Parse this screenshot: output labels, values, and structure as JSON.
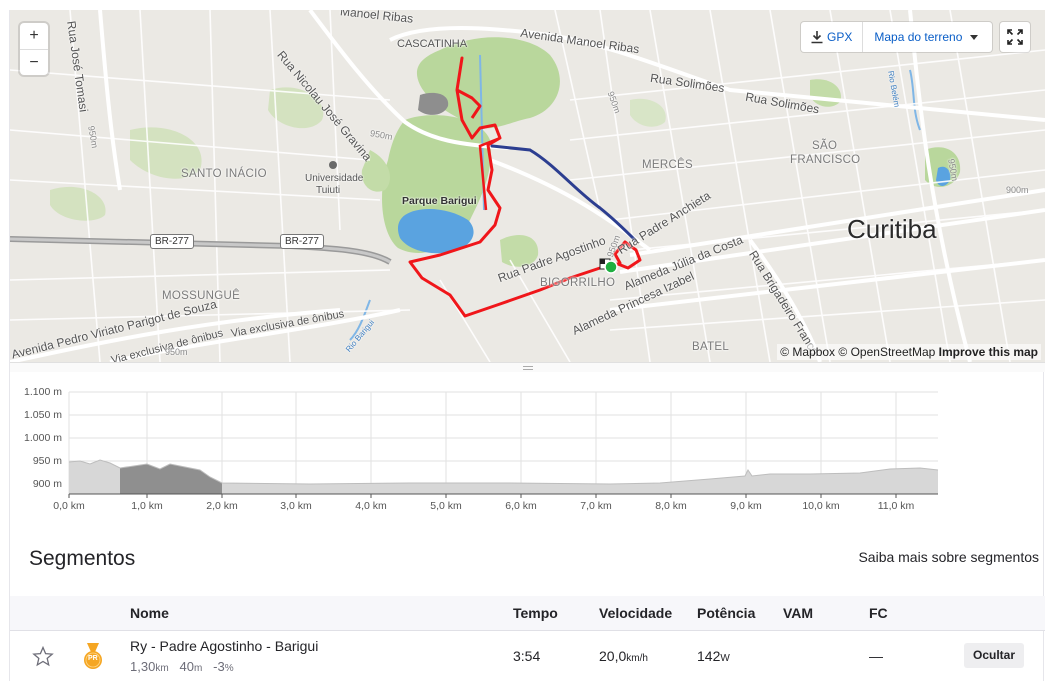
{
  "map": {
    "zoom_in": "+",
    "zoom_out": "−",
    "gpx_label": "GPX",
    "map_type": "Mapa do terreno",
    "attribution_mapbox": "© Mapbox",
    "attribution_osm": "© OpenStreetMap",
    "improve_link": "Improve this map",
    "labels": {
      "city": "Curitiba",
      "cascatinha": "CASCATINHA",
      "santo_inacio": "SANTO INÁCIO",
      "merces": "MERCÊS",
      "sao_francisco_1": "SÃO",
      "sao_francisco_2": "FRANCISCO",
      "mossungue": "MOSSUNGUÊ",
      "bigorrilho": "BIGORRILHO",
      "batel": "BATEL",
      "universidade_1": "Universidade",
      "universidade_2": "Tuiuti",
      "parque_barigui": "Parque Barigui",
      "av_manoel_ribas": "Avenida Manoel Ribas",
      "manoel_ribas_top": "Manoel Ribas",
      "rua_solimoes_1": "Rua Solimões",
      "rua_solimoes_2": "Rua Solimões",
      "rua_nicolau": "Rua Nicolau José Gravina",
      "rua_jose_tomasi": "Rua José Tomasi",
      "rua_padre_agostinho": "Rua Padre Agostinho",
      "rua_padre_anchieta": "Rua Padre Anchieta",
      "alameda_julia": "Alameda Júlia da Costa",
      "alameda_princesa": "Alameda Princesa Izabel",
      "rua_brigadeiro": "Rua Brigadeiro Franco",
      "av_pedro_viriato": "Avenida Pedro Viriato Parigot de Souza",
      "via_exclusiva_1": "Via exclusiva de ônibus",
      "via_exclusiva_2": "Via exclusiva de ônibus",
      "rio_barigui": "Rio Barigui",
      "rio_belem": "Rio Belém",
      "br277_a": "BR-277",
      "br277_b": "BR-277",
      "alt_950_a": "950m",
      "alt_950_b": "950m",
      "alt_950_c": "950m",
      "alt_950_d": "950m",
      "alt_950_e": "950m",
      "alt_900": "900m",
      "alt_950_f": "950m"
    }
  },
  "profile": {
    "y_ticks": [
      "1.100 m",
      "1.050 m",
      "1.000 m",
      "950 m",
      "900 m"
    ],
    "x_ticks": [
      "0,0 km",
      "1,0 km",
      "2,0 km",
      "3,0 km",
      "4,0 km",
      "5,0 km",
      "6,0 km",
      "7,0 km",
      "8,0 km",
      "9,0 km",
      "10,0 km",
      "11,0 km"
    ]
  },
  "segments": {
    "title": "Segmentos",
    "learn_more": "Saiba mais sobre segmentos",
    "columns": {
      "name": "Nome",
      "time": "Tempo",
      "speed": "Velocidade",
      "power": "Potência",
      "vam": "VAM",
      "hr": "FC"
    },
    "rows": [
      {
        "name": "Ry - Padre Agostinho - Barigui",
        "distance": "1,30",
        "distance_unit": "km",
        "elevation": "40",
        "elevation_unit": "m",
        "grade": "-3",
        "grade_unit": "%",
        "time": "3:54",
        "speed": "20,0",
        "speed_unit": "km/h",
        "power": "142",
        "power_unit": "W",
        "hr": "—",
        "hide_label": "Ocultar",
        "badge": "PR"
      }
    ]
  },
  "colors": {
    "route": "#f0161a",
    "segment": "#2c3e90",
    "park": "#b7d69a",
    "water": "#5aa3e0",
    "medal": "#f5a623",
    "link": "#0a5ec7"
  }
}
